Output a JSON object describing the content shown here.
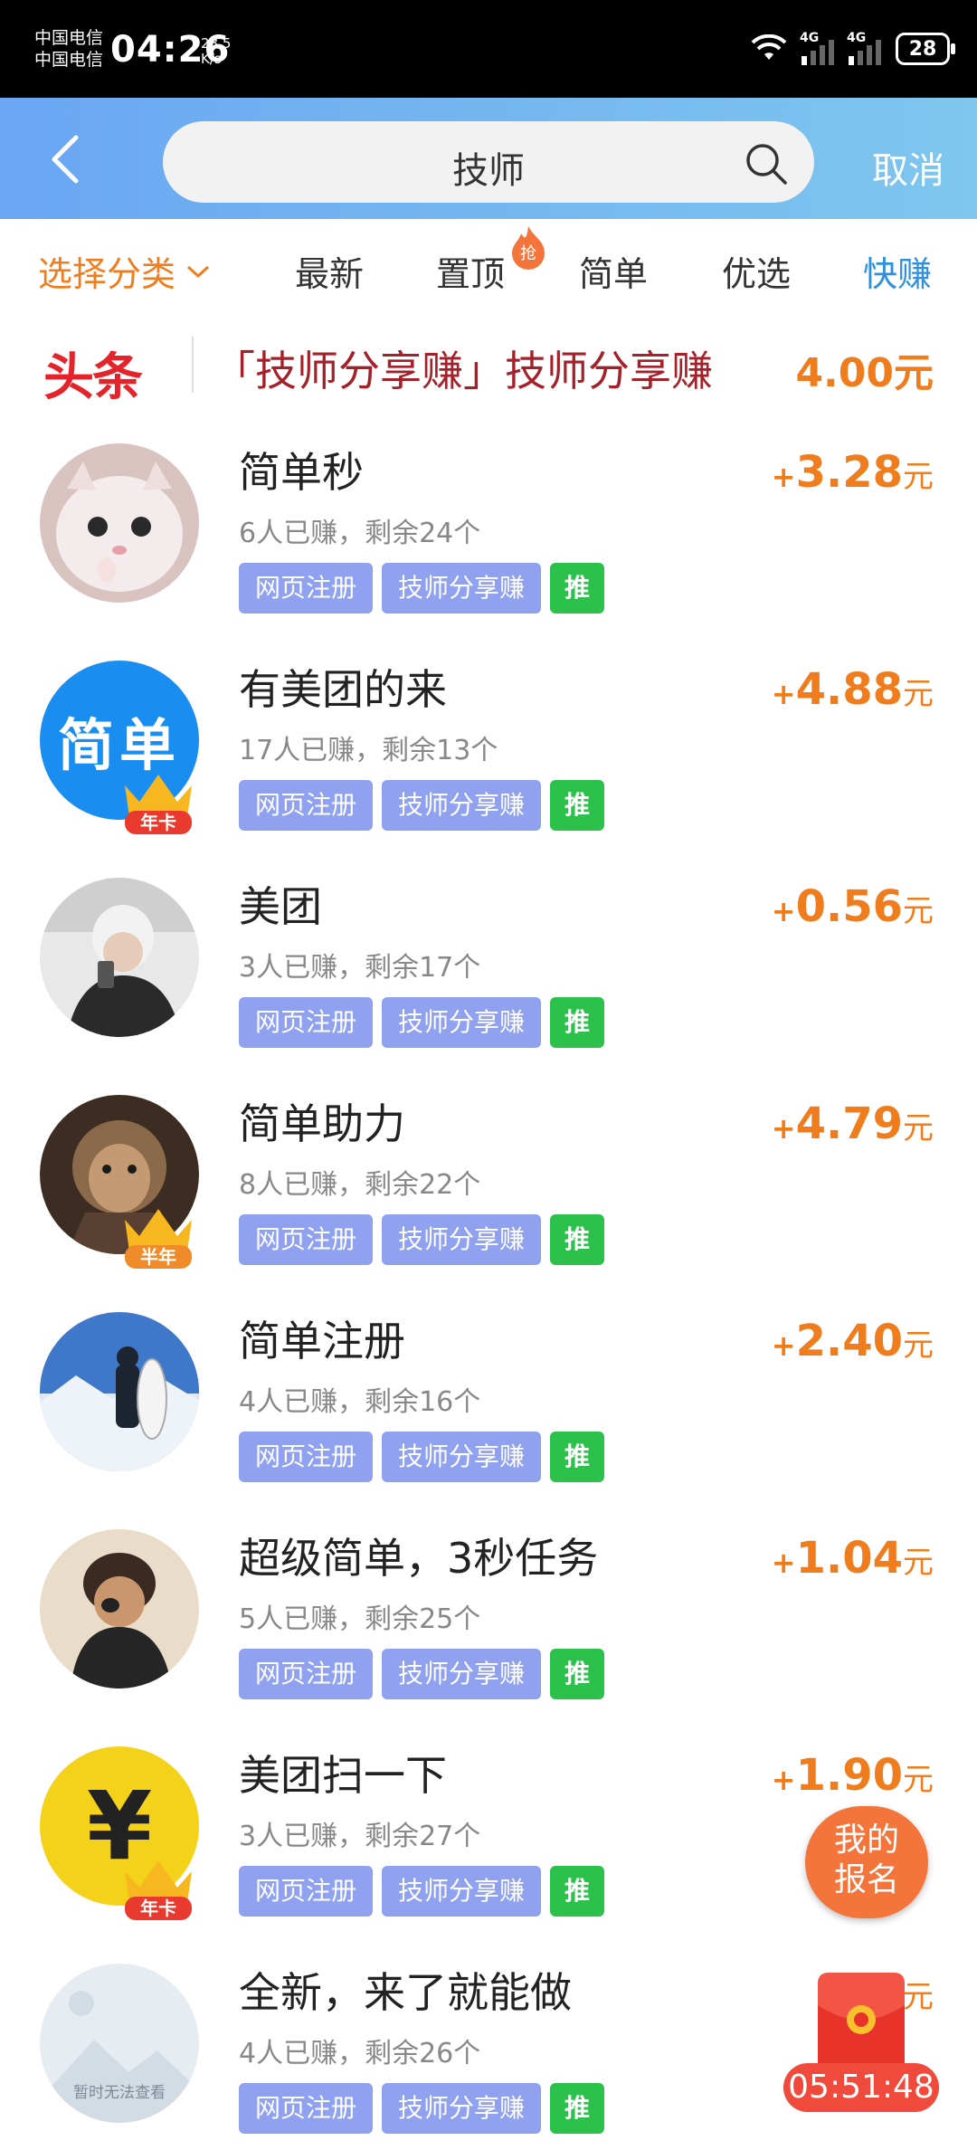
{
  "status_bar": {
    "carrier1": "中国电信",
    "carrier2": "中国电信",
    "time": "04:26",
    "speed_value": "28.5",
    "speed_unit": "K/s",
    "network1": "4G",
    "network2": "4G",
    "battery": "28"
  },
  "search": {
    "query": "技师",
    "cancel_label": "取消"
  },
  "tabs": {
    "category": "选择分类",
    "items": [
      "最新",
      "置顶",
      "简单",
      "优选",
      "快赚"
    ],
    "hot_badge": "抢"
  },
  "headline": {
    "logo": "头条",
    "text": "「技师分享赚」技师分享赚",
    "price": "4.00元"
  },
  "tasks": [
    {
      "title": "简单秒",
      "meta": "6人已赚，剩余24个",
      "tags": [
        "网页注册",
        "技师分享赚",
        "推"
      ],
      "plus": "+",
      "reward": "3.28",
      "unit": "元"
    },
    {
      "title": "有美团的来",
      "meta": "17人已赚，剩余13个",
      "tags": [
        "网页注册",
        "技师分享赚",
        "推"
      ],
      "plus": "+",
      "reward": "4.88",
      "unit": "元",
      "avatar_text": "简单",
      "crown_text": "年卡"
    },
    {
      "title": "美团",
      "meta": "3人已赚，剩余17个",
      "tags": [
        "网页注册",
        "技师分享赚",
        "推"
      ],
      "plus": "+",
      "reward": "0.56",
      "unit": "元"
    },
    {
      "title": "简单助力",
      "meta": "8人已赚，剩余22个",
      "tags": [
        "网页注册",
        "技师分享赚",
        "推"
      ],
      "plus": "+",
      "reward": "4.79",
      "unit": "元",
      "crown_text": "半年"
    },
    {
      "title": "简单注册",
      "meta": "4人已赚，剩余16个",
      "tags": [
        "网页注册",
        "技师分享赚",
        "推"
      ],
      "plus": "+",
      "reward": "2.40",
      "unit": "元"
    },
    {
      "title": "超级简单，3秒任务",
      "meta": "5人已赚，剩余25个",
      "tags": [
        "网页注册",
        "技师分享赚",
        "推"
      ],
      "plus": "+",
      "reward": "1.04",
      "unit": "元"
    },
    {
      "title": "美团扫一下",
      "meta": "3人已赚，剩余27个",
      "tags": [
        "网页注册",
        "技师分享赚",
        "推"
      ],
      "plus": "+",
      "reward": "1.90",
      "unit": "元",
      "avatar_text": "¥",
      "crown_text": "年卡"
    },
    {
      "title": "全新，来了就能做",
      "meta": "4人已赚，剩余26个",
      "tags": [
        "网页注册",
        "技师分享赚",
        "推"
      ],
      "plus": "+",
      "reward": "",
      "unit": "元",
      "avatar_text": "暂时无法查看"
    }
  ],
  "floating": {
    "my_signup_line1": "我的",
    "my_signup_line2": "报名",
    "countdown": "05:51:48"
  },
  "colors": {
    "accent_orange": "#ef7d1e",
    "active_blue": "#2f8fe0",
    "tag_blue": "#8fa1ef",
    "tag_green": "#2bc14a",
    "headline_red": "#e5232a"
  }
}
